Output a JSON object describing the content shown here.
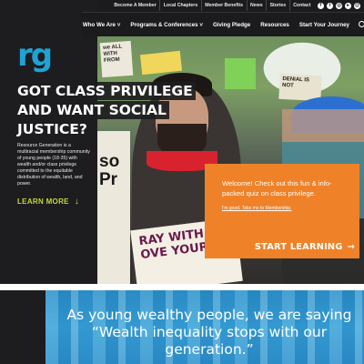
{
  "top_links": [
    "Become A Member",
    "Local Chapters",
    "Member Benefits",
    "News",
    "Stories",
    "Contact"
  ],
  "social_icons": [
    "facebook-icon",
    "twitter-icon",
    "instagram-icon",
    "youtube-icon",
    "email-icon"
  ],
  "main_nav": {
    "items": [
      "Who We Are ˅",
      "Programs & Conferences ˅",
      "Giving Pledge",
      "Resources",
      "Start Your Journey"
    ],
    "search_icon": "search-icon"
  },
  "logo": {
    "text": "rg",
    "color": "#1fa3d6"
  },
  "hero": {
    "headline_lines": [
      "GOT CLASS PRIVILEGE",
      "AND WANT SOCIAL",
      "JUSTICE?"
    ],
    "intro": "Resource Generation is a multiracial membership community of young people (18-35) with wealth and/or class privilege committed to the equitable distribution of wealth, land, and power.",
    "learn_more": "LEARN MORE",
    "learn_more_arrow": "↓",
    "accent_color": "#c6d63c",
    "photo_signs": {
      "sign1": "we ALL WITH FROM",
      "sign4": "DENIAL IS NOT",
      "left_sign": "so Pr",
      "poster": "RAY WITH\nOVE YOUR"
    }
  },
  "cta_box": {
    "welcome": "Welcome! Check out this fun & info-packed quiz on class privilege.",
    "member_link": "I'm good. Take me to Membership.",
    "start_learning": "START LEARNING",
    "start_arrow": "→",
    "color": "#ef8228"
  },
  "banner": {
    "quote": "As young wealthy people, we are saying “Wealth inequality stops with our generation.”",
    "color": "#2b8dc7"
  }
}
